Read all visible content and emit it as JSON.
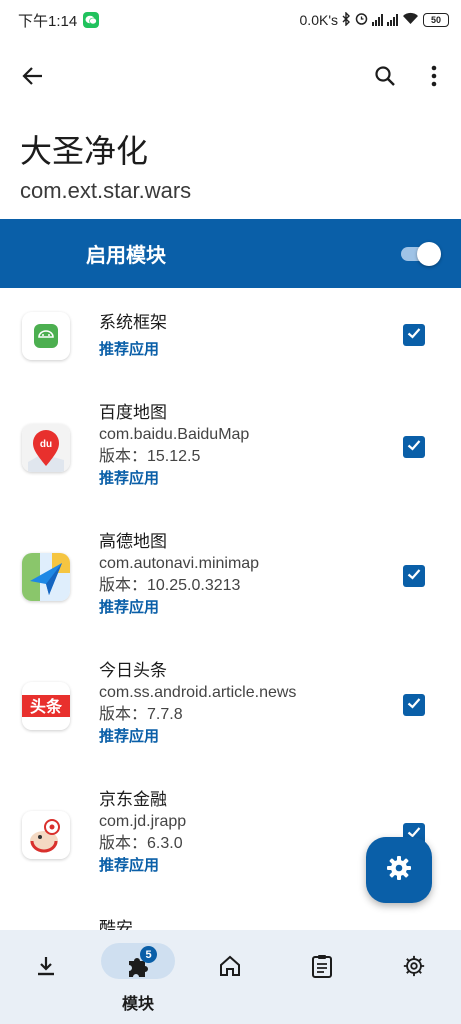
{
  "status_bar": {
    "time": "下午1:14",
    "network_speed": "0.0K's",
    "battery": "50",
    "icons": [
      "wechat-icon",
      "bluetooth-icon",
      "alarm-icon",
      "signal-icon",
      "signal-icon",
      "wifi-icon",
      "battery-icon"
    ]
  },
  "toolbar": {
    "back_icon": "arrow-back-icon",
    "search_icon": "search-icon",
    "more_icon": "more-vert-icon"
  },
  "header": {
    "title": "大圣净化",
    "package": "com.ext.star.wars"
  },
  "enable_bar": {
    "label": "启用模块",
    "enabled": true
  },
  "apps": [
    {
      "name": "系统框架",
      "package": "",
      "version": "",
      "recommend": "推荐应用",
      "checked": true
    },
    {
      "name": "百度地图",
      "package": "com.baidu.BaiduMap",
      "version": "版本：15.12.5",
      "recommend": "推荐应用",
      "checked": true
    },
    {
      "name": "高德地图",
      "package": "com.autonavi.minimap",
      "version": "版本：10.25.0.3213",
      "recommend": "推荐应用",
      "checked": true
    },
    {
      "name": "今日头条",
      "package": "com.ss.android.article.news",
      "version": "版本：7.7.8",
      "recommend": "推荐应用",
      "checked": true
    },
    {
      "name": "京东金融",
      "package": "com.jd.jrapp",
      "version": "版本：6.3.0",
      "recommend": "推荐应用",
      "checked": true
    },
    {
      "name": "酷安",
      "package": "",
      "version": "",
      "recommend": "",
      "checked": false
    }
  ],
  "app_icon_texts": {
    "baidu": "du",
    "toutiao": "头条"
  },
  "fab": {
    "icon": "gear-icon"
  },
  "bottom_nav": {
    "items": [
      {
        "icon": "download-icon",
        "label": ""
      },
      {
        "icon": "puzzle-icon",
        "label": "模块",
        "badge": "5",
        "active": true
      },
      {
        "icon": "home-icon",
        "label": ""
      },
      {
        "icon": "clipboard-icon",
        "label": ""
      },
      {
        "icon": "gear-icon",
        "label": ""
      }
    ]
  },
  "colors": {
    "accent": "#0a5fa8",
    "nav_background": "#e9eff6",
    "nav_pill": "#cfdff0"
  }
}
